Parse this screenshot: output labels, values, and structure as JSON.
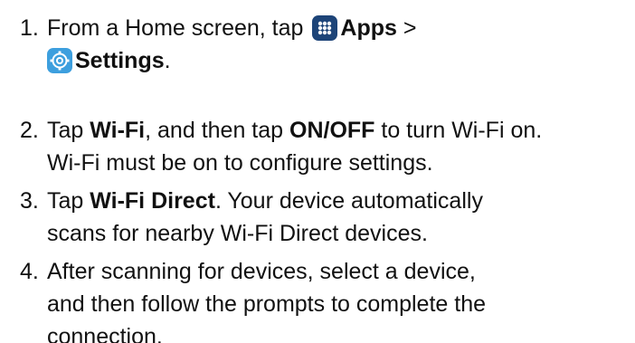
{
  "steps": [
    {
      "number": "1.",
      "line1_pre": "From a Home screen, tap",
      "apps_label": "Apps",
      "arrow": ">",
      "settings_label": "Settings",
      "period": "."
    },
    {
      "number": "2.",
      "pre": "Tap",
      "wifi": "Wi-Fi",
      "mid": ", and then tap",
      "onoff": "ON/OFF",
      "post": "to turn Wi-Fi on.",
      "line2": "Wi-Fi must be on to configure settings."
    },
    {
      "number": "3.",
      "pre": "Tap",
      "wifi_direct": "Wi-Fi Direct",
      "post": ". Your device automatically",
      "line2": "scans for nearby Wi-Fi Direct devices."
    },
    {
      "number": "4.",
      "line1": "After scanning for devices, select a device,",
      "line2": "and then follow the prompts to complete the",
      "line3": "connection."
    }
  ],
  "icons": {
    "apps": {
      "name": "apps-icon",
      "color": "#1d4478"
    },
    "settings": {
      "name": "settings-icon",
      "color": "#3d9fde"
    }
  }
}
